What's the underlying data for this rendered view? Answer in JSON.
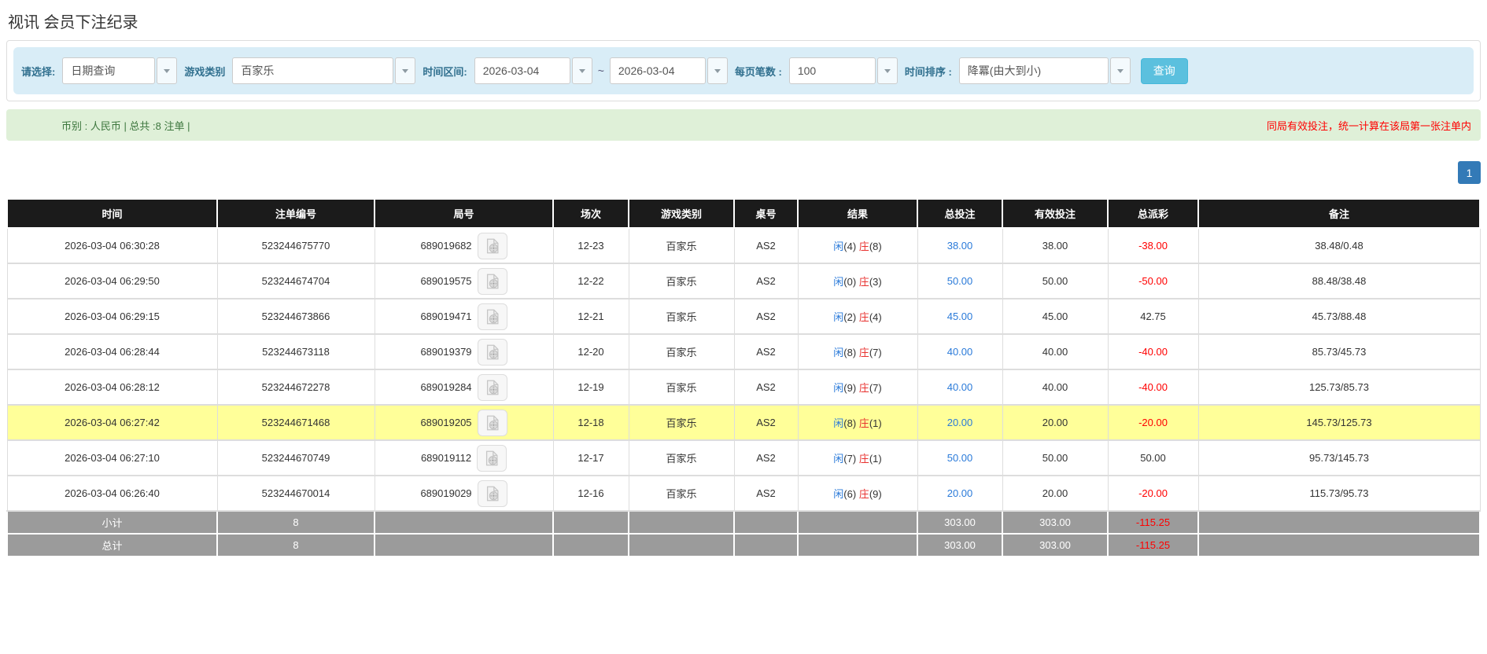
{
  "page_title": "视讯 会员下注纪录",
  "filters": {
    "select_label": "请选择:",
    "select_value": "日期查询",
    "game_type_label": "游戏类别",
    "game_type_value": "百家乐",
    "time_range_label": "时间区间:",
    "date_from": "2026-03-04",
    "tilde": "~",
    "date_to": "2026-03-04",
    "page_size_label": "每页笔数 :",
    "page_size_value": "100",
    "sort_label": "时间排序 :",
    "sort_value": "降冪(由大到小)",
    "search_button": "查询"
  },
  "summary_bar": {
    "left_text": "币别 : 人民币 | 总共 :8 注单 |",
    "right_notice": "同局有效投注，统一计算在该局第一张注单内"
  },
  "pagination": {
    "current_page": "1"
  },
  "icons": {
    "caret": "chevron-down-icon",
    "round_video": "video-record-icon"
  },
  "colors": {
    "accent_blue": "#2a7ad9",
    "link_blue": "#337ab7",
    "negative_red": "#ff0000",
    "banker_red": "#e8322f",
    "highlight_yellow": "#ffff99",
    "header_bg": "#1b1b1b",
    "summary_gray": "#9b9b9b",
    "panel_blue": "#d9edf7",
    "alert_green_bg": "#dff0d8",
    "alert_green_text": "#3c763d",
    "button_blue": "#5bc0de",
    "label_blue": "#31708f"
  },
  "table": {
    "headers": [
      "时间",
      "注单编号",
      "局号",
      "场次",
      "游戏类别",
      "桌号",
      "结果",
      "总投注",
      "有效投注",
      "总派彩",
      "备注"
    ],
    "rows": [
      {
        "time": "2026-03-04 06:30:28",
        "bet_no": "523244675770",
        "round_no": "689019682",
        "session": "12-23",
        "game": "百家乐",
        "table_no": "AS2",
        "result": {
          "player": "闲",
          "player_pts": "(4)",
          "banker": "庄",
          "banker_pts": "(8)"
        },
        "total_bet": "38.00",
        "valid_bet": "38.00",
        "payout": "-38.00",
        "remark": "38.48/0.48",
        "highlight": false
      },
      {
        "time": "2026-03-04 06:29:50",
        "bet_no": "523244674704",
        "round_no": "689019575",
        "session": "12-22",
        "game": "百家乐",
        "table_no": "AS2",
        "result": {
          "player": "闲",
          "player_pts": "(0)",
          "banker": "庄",
          "banker_pts": "(3)"
        },
        "total_bet": "50.00",
        "valid_bet": "50.00",
        "payout": "-50.00",
        "remark": "88.48/38.48",
        "highlight": false
      },
      {
        "time": "2026-03-04 06:29:15",
        "bet_no": "523244673866",
        "round_no": "689019471",
        "session": "12-21",
        "game": "百家乐",
        "table_no": "AS2",
        "result": {
          "player": "闲",
          "player_pts": "(2)",
          "banker": "庄",
          "banker_pts": "(4)"
        },
        "total_bet": "45.00",
        "valid_bet": "45.00",
        "payout": "42.75",
        "remark": "45.73/88.48",
        "highlight": false
      },
      {
        "time": "2026-03-04 06:28:44",
        "bet_no": "523244673118",
        "round_no": "689019379",
        "session": "12-20",
        "game": "百家乐",
        "table_no": "AS2",
        "result": {
          "player": "闲",
          "player_pts": "(8)",
          "banker": "庄",
          "banker_pts": "(7)"
        },
        "total_bet": "40.00",
        "valid_bet": "40.00",
        "payout": "-40.00",
        "remark": "85.73/45.73",
        "highlight": false
      },
      {
        "time": "2026-03-04 06:28:12",
        "bet_no": "523244672278",
        "round_no": "689019284",
        "session": "12-19",
        "game": "百家乐",
        "table_no": "AS2",
        "result": {
          "player": "闲",
          "player_pts": "(9)",
          "banker": "庄",
          "banker_pts": "(7)"
        },
        "total_bet": "40.00",
        "valid_bet": "40.00",
        "payout": "-40.00",
        "remark": "125.73/85.73",
        "highlight": false
      },
      {
        "time": "2026-03-04 06:27:42",
        "bet_no": "523244671468",
        "round_no": "689019205",
        "session": "12-18",
        "game": "百家乐",
        "table_no": "AS2",
        "result": {
          "player": "闲",
          "player_pts": "(8)",
          "banker": "庄",
          "banker_pts": "(1)"
        },
        "total_bet": "20.00",
        "valid_bet": "20.00",
        "payout": "-20.00",
        "remark": "145.73/125.73",
        "highlight": true
      },
      {
        "time": "2026-03-04 06:27:10",
        "bet_no": "523244670749",
        "round_no": "689019112",
        "session": "12-17",
        "game": "百家乐",
        "table_no": "AS2",
        "result": {
          "player": "闲",
          "player_pts": "(7)",
          "banker": "庄",
          "banker_pts": "(1)"
        },
        "total_bet": "50.00",
        "valid_bet": "50.00",
        "payout": "50.00",
        "remark": "95.73/145.73",
        "highlight": false
      },
      {
        "time": "2026-03-04 06:26:40",
        "bet_no": "523244670014",
        "round_no": "689019029",
        "session": "12-16",
        "game": "百家乐",
        "table_no": "AS2",
        "result": {
          "player": "闲",
          "player_pts": "(6)",
          "banker": "庄",
          "banker_pts": "(9)"
        },
        "total_bet": "20.00",
        "valid_bet": "20.00",
        "payout": "-20.00",
        "remark": "115.73/95.73",
        "highlight": false
      }
    ],
    "summary_rows": [
      {
        "label": "小计",
        "count": "8",
        "total_bet": "303.00",
        "valid_bet": "303.00",
        "payout": "-115.25"
      },
      {
        "label": "总计",
        "count": "8",
        "total_bet": "303.00",
        "valid_bet": "303.00",
        "payout": "-115.25"
      }
    ]
  }
}
